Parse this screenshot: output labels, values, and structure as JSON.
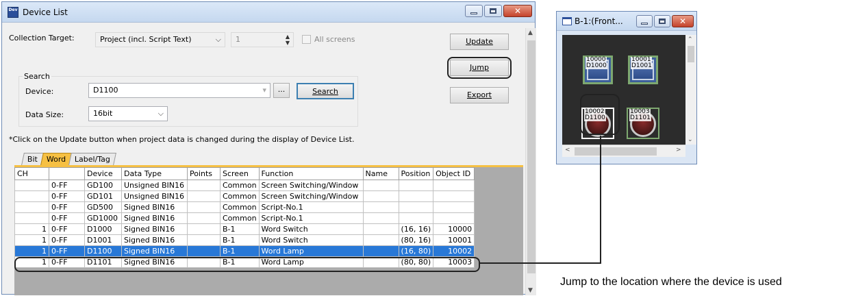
{
  "main_window": {
    "title": "Device List",
    "icon_text": "Dev"
  },
  "collection": {
    "label": "Collection Target:",
    "target_value": "Project (incl. Script Text)",
    "number_value": "1",
    "all_screens_label": "All screens"
  },
  "search": {
    "group_label": "Search",
    "device_label": "Device:",
    "device_value": "D1100",
    "browse_label": "...",
    "search_button": "Search",
    "data_size_label": "Data Size:",
    "data_size_value": "16bit"
  },
  "buttons": {
    "update": "Update",
    "jump": "Jump",
    "export": "Export"
  },
  "note": "*Click on the Update button when project data is changed during the display of Device List.",
  "tabs": [
    {
      "label": "Bit"
    },
    {
      "label": "Word"
    },
    {
      "label": "Label/Tag"
    }
  ],
  "table": {
    "columns": [
      "CH",
      "",
      "Device",
      "Data Type",
      "Points",
      "Screen",
      "Function",
      "Name",
      "Position",
      "Object ID"
    ],
    "rows": [
      {
        "ch": "",
        "range": "0-FF",
        "device": "GD100",
        "data_type": "Unsigned BIN16",
        "points": "",
        "screen": "Common",
        "function": "Screen Switching/Window",
        "name": "",
        "position": "",
        "object_id": ""
      },
      {
        "ch": "",
        "range": "0-FF",
        "device": "GD101",
        "data_type": "Unsigned BIN16",
        "points": "",
        "screen": "Common",
        "function": "Screen Switching/Window",
        "name": "",
        "position": "",
        "object_id": ""
      },
      {
        "ch": "",
        "range": "0-FF",
        "device": "GD500",
        "data_type": "Signed BIN16",
        "points": "",
        "screen": "Common",
        "function": "Script-No.1",
        "name": "",
        "position": "",
        "object_id": ""
      },
      {
        "ch": "",
        "range": "0-FF",
        "device": "GD1000",
        "data_type": "Signed BIN16",
        "points": "",
        "screen": "Common",
        "function": "Script-No.1",
        "name": "",
        "position": "",
        "object_id": ""
      },
      {
        "ch": "1",
        "range": "0-FF",
        "device": "D1000",
        "data_type": "Signed BIN16",
        "points": "",
        "screen": "B-1",
        "function": "Word Switch",
        "name": "",
        "position": "(16, 16)",
        "object_id": "10000"
      },
      {
        "ch": "1",
        "range": "0-FF",
        "device": "D1001",
        "data_type": "Signed BIN16",
        "points": "",
        "screen": "B-1",
        "function": "Word Switch",
        "name": "",
        "position": "(80, 16)",
        "object_id": "10001"
      },
      {
        "ch": "1",
        "range": "0-FF",
        "device": "D1100",
        "data_type": "Signed BIN16",
        "points": "",
        "screen": "B-1",
        "function": "Word Lamp",
        "name": "",
        "position": "(16, 80)",
        "object_id": "10002"
      },
      {
        "ch": "1",
        "range": "0-FF",
        "device": "D1101",
        "data_type": "Signed BIN16",
        "points": "",
        "screen": "B-1",
        "function": "Word Lamp",
        "name": "",
        "position": "(80, 80)",
        "object_id": "10003"
      }
    ]
  },
  "screen_window": {
    "title": "B-1:(Front...",
    "objects": [
      {
        "id": "10000",
        "device": "D1000"
      },
      {
        "id": "10001",
        "device": "D1001"
      },
      {
        "id": "10002",
        "device": "D1100"
      },
      {
        "id": "10003",
        "device": "D1101"
      }
    ]
  },
  "caption": "Jump to the location where the device is used"
}
